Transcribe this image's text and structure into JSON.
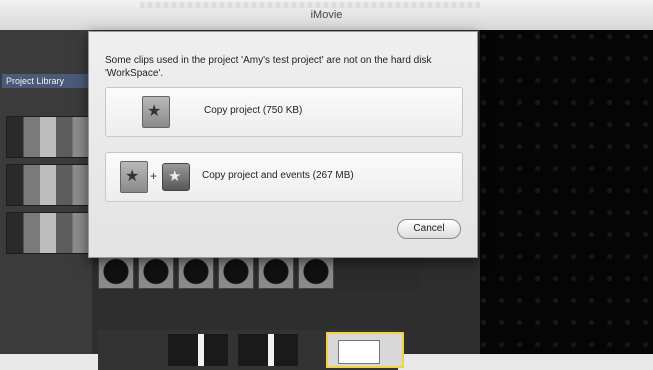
{
  "window": {
    "title": "iMovie"
  },
  "left_panel": {
    "project_label": "Project Library"
  },
  "sheet": {
    "message": "Some clips used in the project 'Amy's test project' are not on the hard disk 'WorkSpace'.",
    "options": [
      {
        "label": "Copy project (750 KB)",
        "icon": "project-icon"
      },
      {
        "label": "Copy project and events (267 MB)",
        "icons": [
          "project-icon",
          "plus-icon",
          "event-icon"
        ]
      }
    ],
    "cancel_label": "Cancel",
    "plus_symbol": "+"
  },
  "colors": {
    "selection_border": "#f3d23f",
    "sheet_bg": "#efefef",
    "viewer_bg": "#050505"
  }
}
